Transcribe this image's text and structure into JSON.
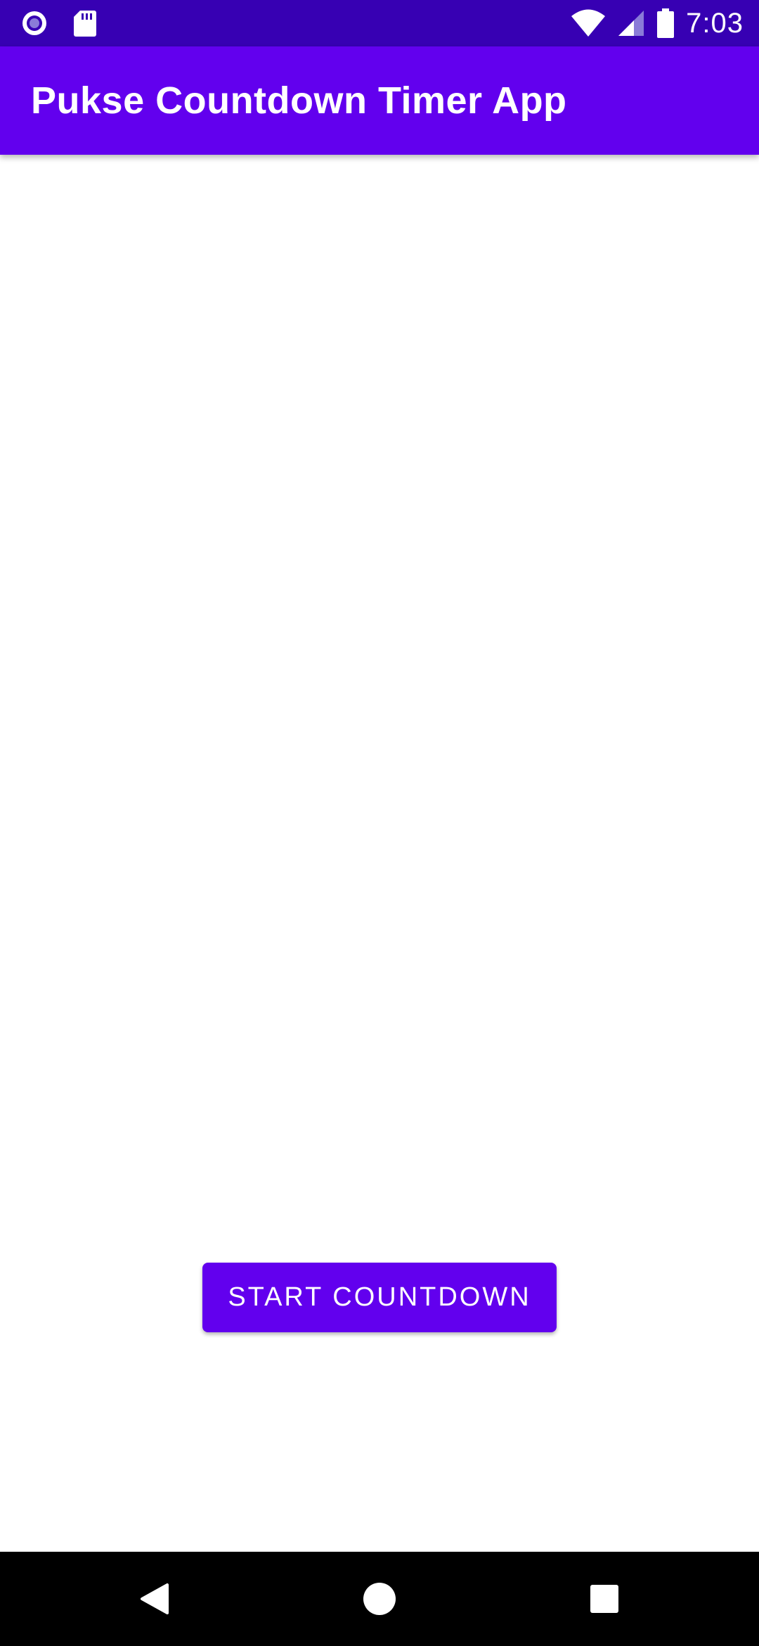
{
  "status_bar": {
    "time": "7:03",
    "left_icons": [
      "record-icon",
      "sd-card-icon"
    ],
    "right_icons": [
      "wifi-icon",
      "cellular-signal-icon",
      "battery-icon"
    ],
    "background": "#3700B3"
  },
  "app_bar": {
    "title": "Pukse Countdown Timer App",
    "background": "#6200EE"
  },
  "main": {
    "start_button_label": "START COUNTDOWN",
    "button_color": "#6200EE"
  },
  "nav_bar": {
    "icons": [
      "back-icon",
      "home-icon",
      "recents-icon"
    ]
  }
}
